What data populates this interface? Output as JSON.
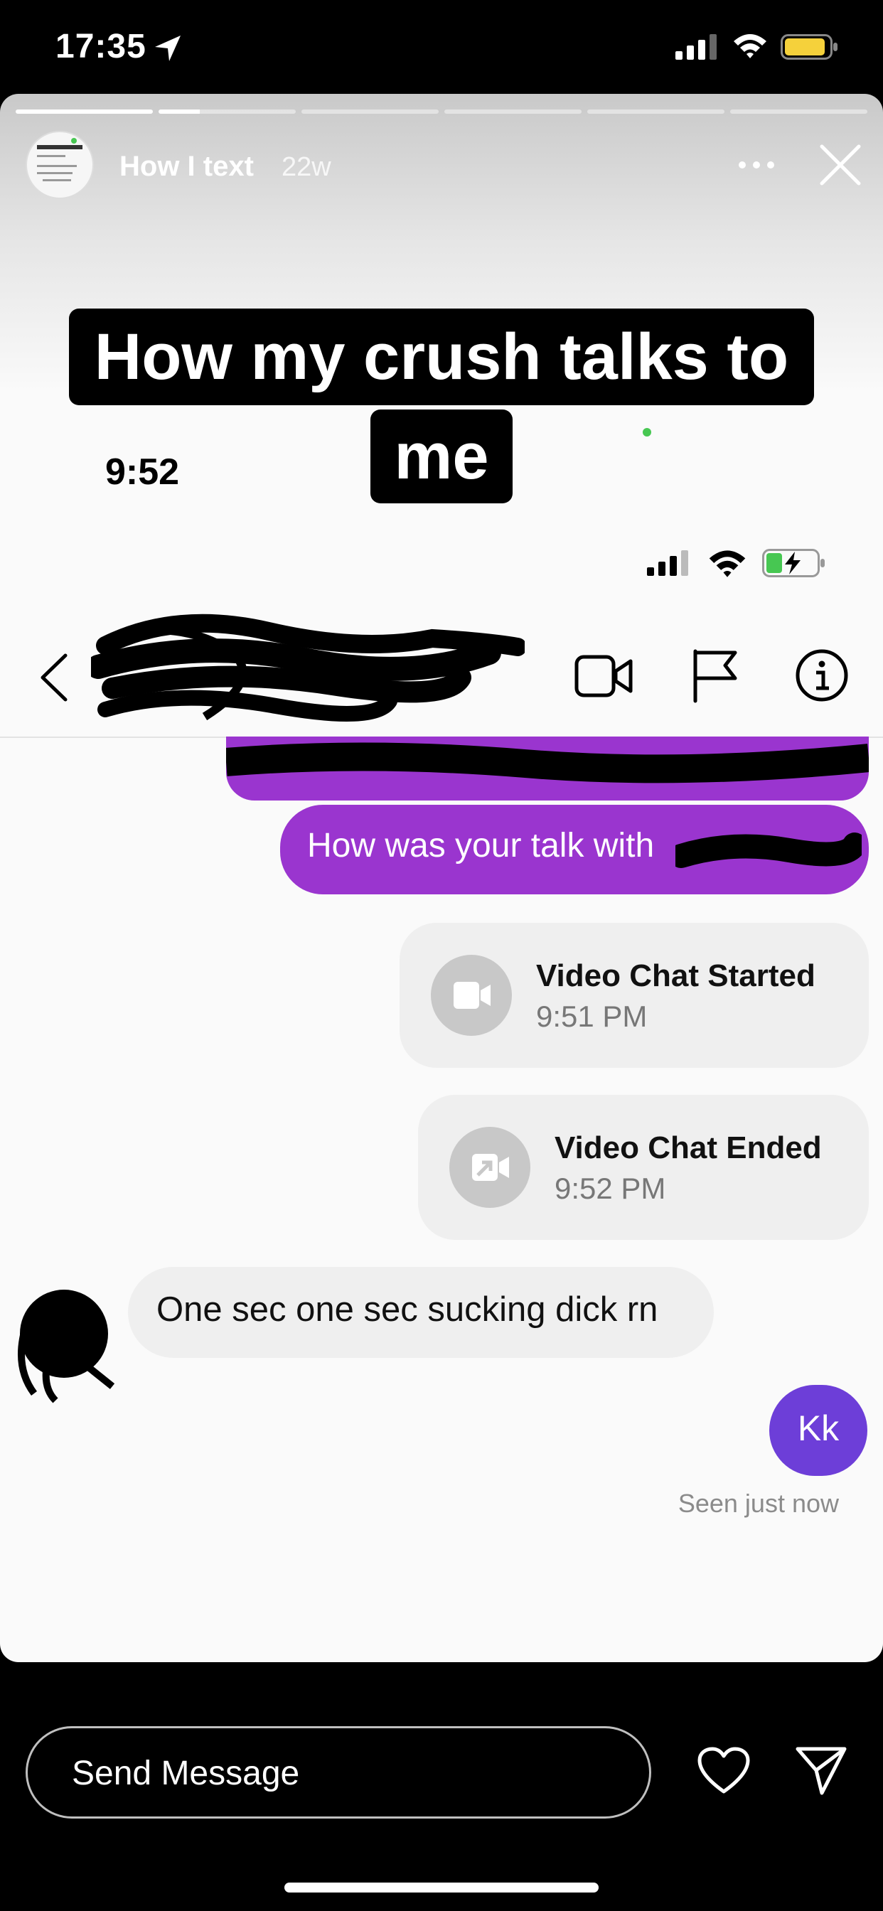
{
  "os_status": {
    "time": "17:35"
  },
  "story": {
    "username": "How I text",
    "age": "22w",
    "segments": 6,
    "caption_line1": "How my crush talks to",
    "caption_line2": "me"
  },
  "inner_status": {
    "time": "9:52"
  },
  "messages": {
    "sent_partial": "How was your talk with",
    "video_started": {
      "title": "Video Chat Started",
      "time": "9:51 PM"
    },
    "video_ended": {
      "title": "Video Chat Ended",
      "time": "9:52 PM"
    },
    "received": "One sec one sec sucking dick rn",
    "reply": "Kk",
    "seen": "Seen just now"
  },
  "reply_bar": {
    "placeholder": "Send Message"
  },
  "colors": {
    "sent_bubble": "#9a35cf",
    "reply_bubble": "#6d3ed8",
    "received_bubble": "#efefef",
    "call_bubble": "#efefef"
  }
}
